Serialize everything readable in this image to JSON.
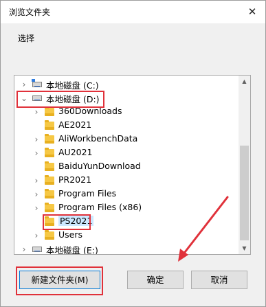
{
  "window": {
    "title": "浏览文件夹",
    "close_glyph": "✕",
    "description": "选择"
  },
  "tree": {
    "items": [
      {
        "label": "本地磁盘 (C:)",
        "type": "drive",
        "expander": "collapsed"
      },
      {
        "label": "本地磁盘 (D:)",
        "type": "drive",
        "expander": "expanded"
      },
      {
        "label": "360Downloads",
        "type": "folder",
        "expander": "collapsed"
      },
      {
        "label": "AE2021",
        "type": "folder",
        "expander": "none"
      },
      {
        "label": "AliWorkbenchData",
        "type": "folder",
        "expander": "collapsed"
      },
      {
        "label": "AU2021",
        "type": "folder",
        "expander": "collapsed"
      },
      {
        "label": "BaiduYunDownload",
        "type": "folder",
        "expander": "none"
      },
      {
        "label": "PR2021",
        "type": "folder",
        "expander": "collapsed"
      },
      {
        "label": "Program Files",
        "type": "folder",
        "expander": "collapsed"
      },
      {
        "label": "Program Files (x86)",
        "type": "folder",
        "expander": "collapsed"
      },
      {
        "label": "PS2021",
        "type": "folder",
        "expander": "none",
        "selected": true
      },
      {
        "label": "Users",
        "type": "folder",
        "expander": "collapsed"
      },
      {
        "label": "本地磁盘 (E:)",
        "type": "drive",
        "expander": "collapsed"
      }
    ]
  },
  "buttons": {
    "new_folder": "新建文件夹(M)",
    "ok": "确定",
    "cancel": "取消"
  },
  "colors": {
    "annotation": "#e0313a",
    "selection": "#cce8ff",
    "focus_border": "#0078d7"
  }
}
